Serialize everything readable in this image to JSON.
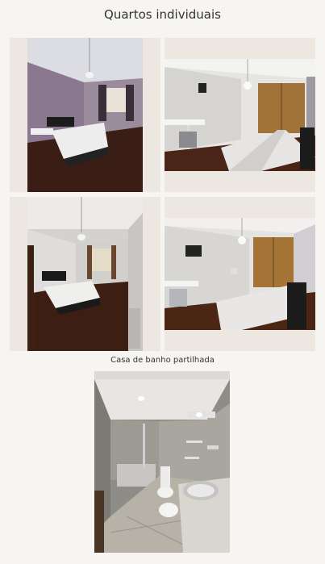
{
  "page": {
    "title": "Quartos individuais",
    "bathroom_caption": "Casa de banho partilhada"
  },
  "photos": [
    {
      "name": "bedroom-photo-1",
      "icon": "bedroom-photo"
    },
    {
      "name": "bedroom-photo-2",
      "icon": "bedroom-photo"
    },
    {
      "name": "bedroom-photo-3",
      "icon": "bedroom-photo"
    },
    {
      "name": "bedroom-photo-4",
      "icon": "bedroom-photo"
    },
    {
      "name": "bathroom-photo",
      "icon": "bathroom-photo"
    }
  ]
}
